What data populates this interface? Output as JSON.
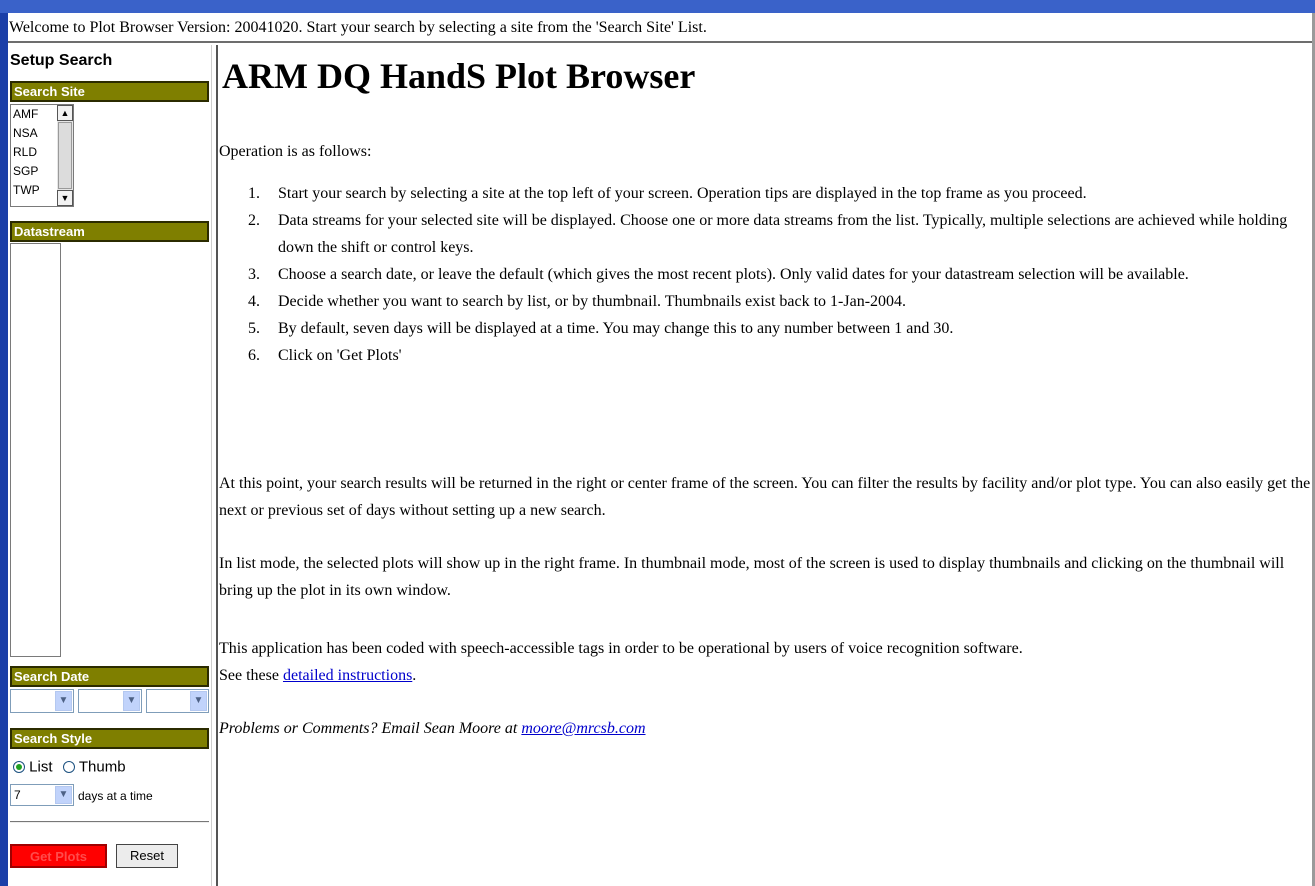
{
  "top_frame": {
    "message": "Welcome to Plot Browser Version: 20041020. Start your search by selecting a site from the 'Search Site' List."
  },
  "left": {
    "setup_title": "Setup Search",
    "search_site": {
      "label": "Search Site",
      "options": [
        "AMF",
        "NSA",
        "RLD",
        "SGP",
        "TWP"
      ]
    },
    "datastream": {
      "label": "Datastream"
    },
    "search_date": {
      "label": "Search Date",
      "month": "",
      "day": "",
      "year": ""
    },
    "search_style": {
      "label": "Search Style",
      "list_label": "List",
      "thumb_label": "Thumb",
      "selected": "List",
      "days_value": "7",
      "days_label": "days at a time"
    },
    "buttons": {
      "get_plots": "Get Plots",
      "reset": "Reset"
    }
  },
  "main": {
    "title": "ARM DQ HandS Plot Browser",
    "intro": "Operation is as follows:",
    "steps": [
      "Start your search by selecting a site at the top left of your screen. Operation tips are displayed in the top frame as you proceed.",
      "Data streams for your selected site will be displayed. Choose one or more data streams from the list. Typically, multiple selections are achieved while holding down the shift or control keys.",
      "Choose a search date, or leave the default (which gives the most recent plots). Only valid dates for your datastream selection will be available.",
      "Decide whether you want to search by list, or by thumbnail. Thumbnails exist back to 1-Jan-2004.",
      "By default, seven days will be displayed at a time. You may change this to any number between 1 and 30.",
      "Click on 'Get Plots'"
    ],
    "step_numbers": [
      "1.",
      "2.",
      "3.",
      "4.",
      "5.",
      "6."
    ],
    "para_point": "At this point, your search results will be returned in the right or center frame of the screen. You can filter the results by facility and/or plot type. You can also easily get the next or previous set of days without setting up a new search.",
    "para_list": "In list mode, the selected plots will show up in the right frame. In thumbnail mode, most of the screen is used to display thumbnails and clicking on the thumbnail will bring up the plot in its own window.",
    "para_speech": "This application has been coded with speech-accessible tags in order to be operational by users of voice recognition software.",
    "see_these": "See these ",
    "instructions_link": "detailed instructions",
    "period": ".",
    "problems_text": "Problems or Comments? Email Sean Moore at ",
    "email_link": "moore@mrcsb.com"
  },
  "colors": {
    "section_bar": "#7f7f00",
    "get_plots_bg": "#ff0000",
    "window_border": "#1b3fa8",
    "link": "#0000cc"
  }
}
